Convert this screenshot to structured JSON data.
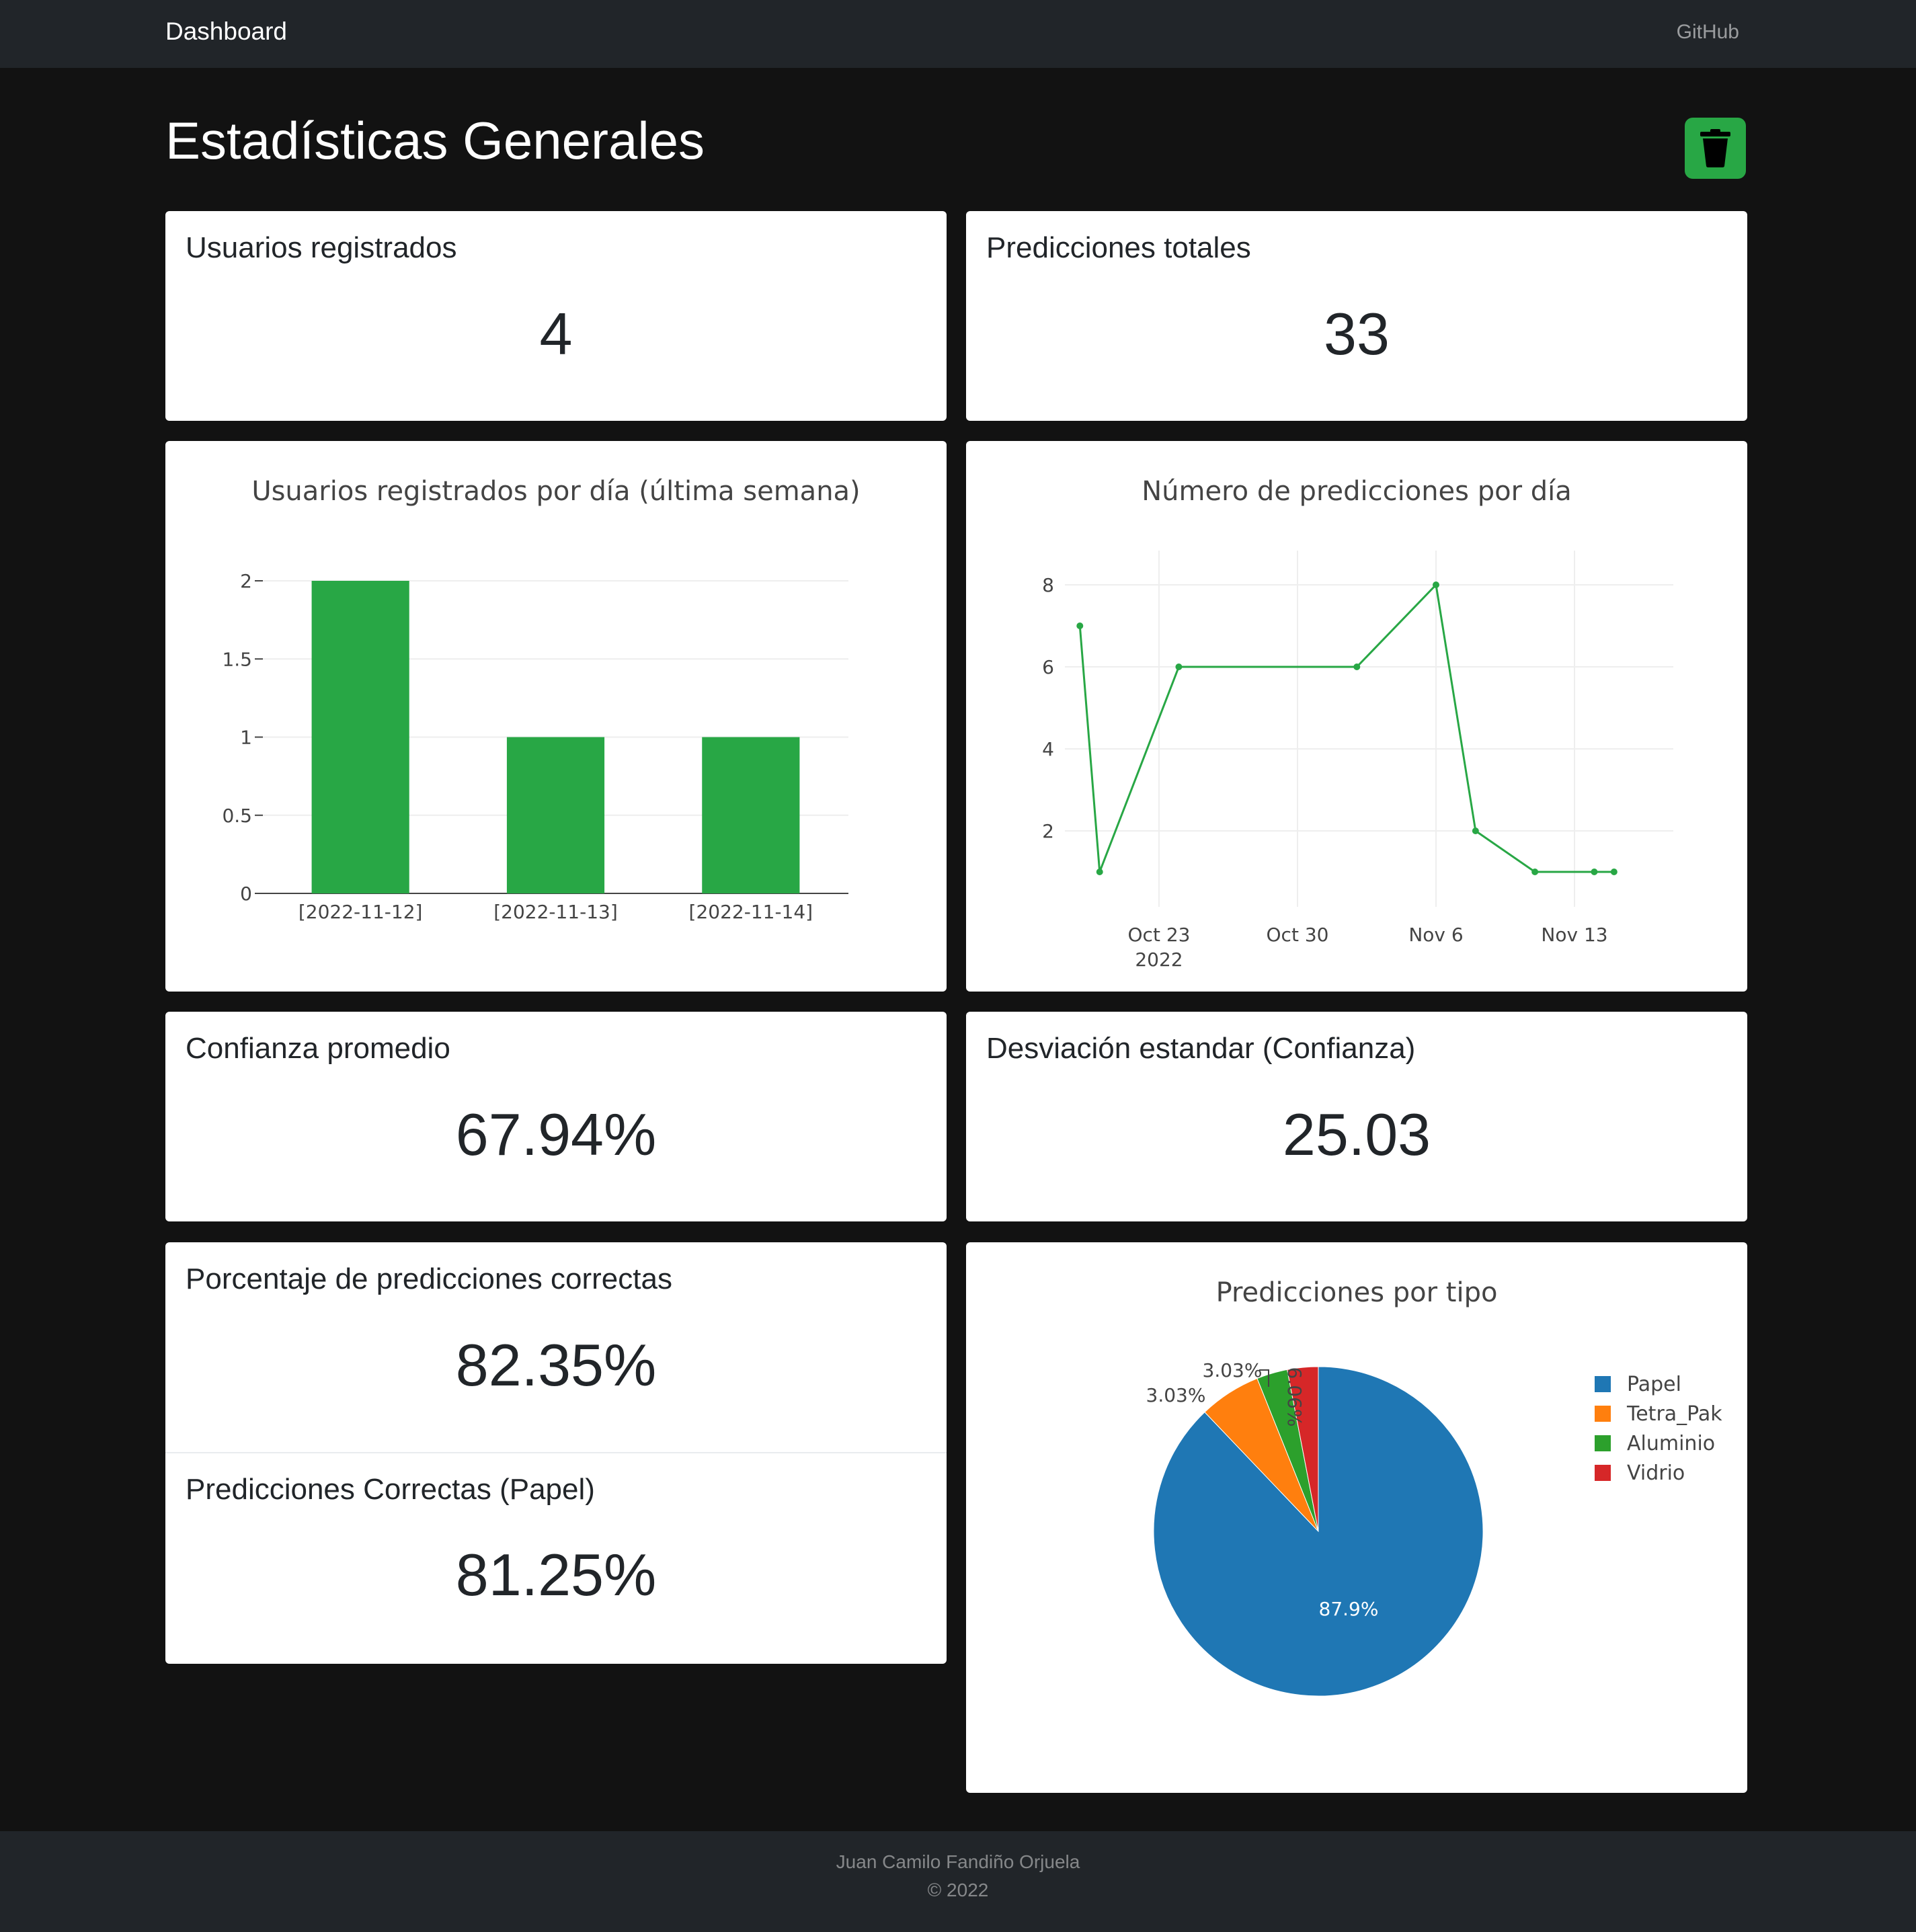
{
  "navbar": {
    "brand": "Dashboard",
    "github": "GitHub"
  },
  "page": {
    "title": "Estadísticas Generales"
  },
  "colors": {
    "accent": "#28a745",
    "navbar_bg": "#212529",
    "page_bg": "#121212"
  },
  "stats": {
    "registered_users": {
      "label": "Usuarios registrados",
      "value": "4"
    },
    "total_predictions": {
      "label": "Predicciones totales",
      "value": "33"
    },
    "avg_confidence": {
      "label": "Confianza promedio",
      "value": "67.94%"
    },
    "std_confidence": {
      "label": "Desviación estandar (Confianza)",
      "value": "25.03"
    },
    "correct_pct": {
      "label": "Porcentaje de predicciones correctas",
      "value": "82.35%"
    },
    "correct_paper": {
      "label": "Predicciones Correctas (Papel)",
      "value": "81.25%"
    }
  },
  "chart_data": [
    {
      "type": "bar",
      "title": "Usuarios registrados por día (última semana)",
      "categories": [
        "[2022-11-12]",
        "[2022-11-13]",
        "[2022-11-14]"
      ],
      "values": [
        2,
        1,
        1
      ],
      "ylim": [
        0,
        2
      ],
      "yticks": [
        "0",
        "0.5",
        "1",
        "1.5",
        "2"
      ],
      "color": "#28a745",
      "grid": true
    },
    {
      "type": "line",
      "title": "Número de predicciones por día",
      "x": [
        "2022-10-19",
        "2022-10-20",
        "2022-10-24",
        "2022-11-02",
        "2022-11-06",
        "2022-11-08",
        "2022-11-11",
        "2022-11-14",
        "2022-11-15"
      ],
      "y": [
        7,
        1,
        6,
        6,
        8,
        2,
        1,
        1,
        1
      ],
      "xticks": [
        "Oct 23",
        "Oct 30",
        "Nov 6",
        "Nov 13"
      ],
      "xtick_sublabel": "2022",
      "yticks": [
        "2",
        "4",
        "6",
        "8"
      ],
      "color": "#28a745",
      "grid": true
    },
    {
      "type": "pie",
      "title": "Predicciones por tipo",
      "labels": [
        "Papel",
        "Tetra_Pak",
        "Aluminio",
        "Vidrio"
      ],
      "values": [
        87.9,
        6.06,
        3.03,
        3.03
      ],
      "value_labels": [
        "87.9%",
        "6.06%",
        "3.03%",
        "3.03%"
      ],
      "colors": [
        "#1f77b4",
        "#ff7f0e",
        "#2ca02c",
        "#d62728"
      ],
      "legend": "right"
    }
  ],
  "footer": {
    "author": "Juan Camilo Fandiño Orjuela",
    "copyright": "© 2022"
  }
}
